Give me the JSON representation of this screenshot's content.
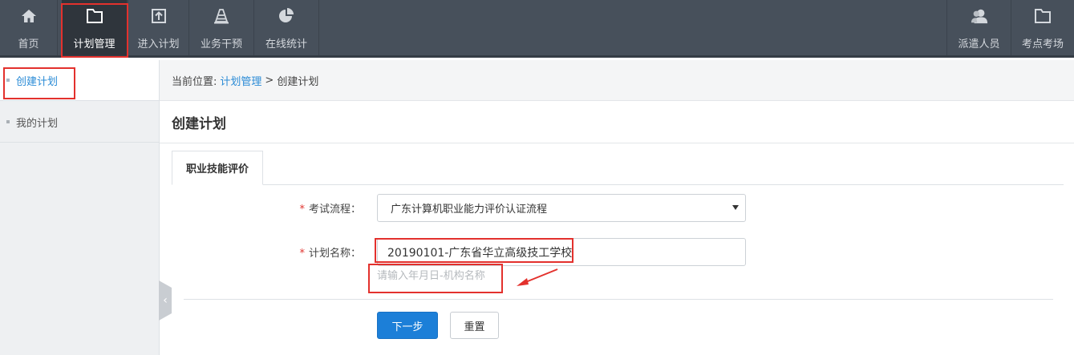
{
  "nav": {
    "items": [
      {
        "label": "首页",
        "icon": "home-icon"
      },
      {
        "label": "计划管理",
        "icon": "folder-icon",
        "active": true
      },
      {
        "label": "进入计划",
        "icon": "upload-box-icon"
      },
      {
        "label": "业务干预",
        "icon": "traffic-cone-icon"
      },
      {
        "label": "在线统计",
        "icon": "pie-chart-icon"
      }
    ],
    "right_items": [
      {
        "label": "派遣人员",
        "icon": "users-icon"
      },
      {
        "label": "考点考场",
        "icon": "folder-icon"
      }
    ]
  },
  "sidebar": {
    "items": [
      {
        "label": "创建计划",
        "active": true
      },
      {
        "label": "我的计划"
      }
    ]
  },
  "breadcrumb": {
    "prefix": "当前位置:",
    "link": "计划管理",
    "separator": ">",
    "current": "创建计划"
  },
  "page": {
    "title": "创建计划",
    "tab": "职业技能评价"
  },
  "form": {
    "exam_flow_label": "考试流程：",
    "exam_flow_value": "广东计算机职业能力评价认证流程",
    "plan_name_label": "计划名称：",
    "plan_name_value": "20190101-广东省华立高级技工学校",
    "plan_name_hint": "请输入年月日-机构名称",
    "required_mark": "*",
    "next_button": "下一步",
    "reset_button": "重置"
  },
  "colors": {
    "nav_bg": "#47505b",
    "accent": "#1c7fd8",
    "highlight": "#e3312d"
  }
}
